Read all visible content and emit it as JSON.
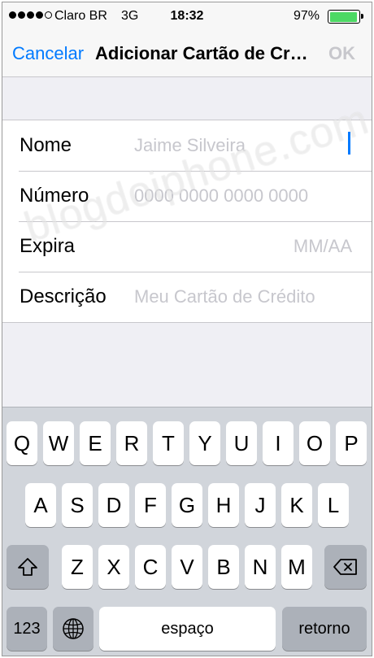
{
  "status_bar": {
    "carrier": "Claro BR",
    "network": "3G",
    "time": "18:32",
    "battery_percent": "97%",
    "battery_level": 0.97,
    "signal_bars": 4,
    "battery_color": "#4cd964"
  },
  "nav": {
    "cancel_label": "Cancelar",
    "title": "Adicionar Cartão de Cr…",
    "ok_label": "OK",
    "accent_color": "#007aff"
  },
  "form": {
    "fields": [
      {
        "label": "Nome",
        "placeholder": "Jaime Silveira"
      },
      {
        "label": "Número",
        "placeholder": "0000 0000 0000 0000"
      },
      {
        "label": "Expira",
        "placeholder": "MM/AA"
      },
      {
        "label": "Descrição",
        "placeholder": "Meu Cartão de Crédito"
      }
    ]
  },
  "watermark": "blogdoiphone.com",
  "keyboard": {
    "row1": [
      "Q",
      "W",
      "E",
      "R",
      "T",
      "Y",
      "U",
      "I",
      "O",
      "P"
    ],
    "row2": [
      "A",
      "S",
      "D",
      "F",
      "G",
      "H",
      "J",
      "K",
      "L"
    ],
    "row3": [
      "Z",
      "X",
      "C",
      "V",
      "B",
      "N",
      "M"
    ],
    "numbers_label": "123",
    "space_label": "espaço",
    "return_label": "retorno",
    "icons": {
      "shift": "shift-icon",
      "delete": "delete-icon",
      "globe": "globe-icon"
    }
  }
}
